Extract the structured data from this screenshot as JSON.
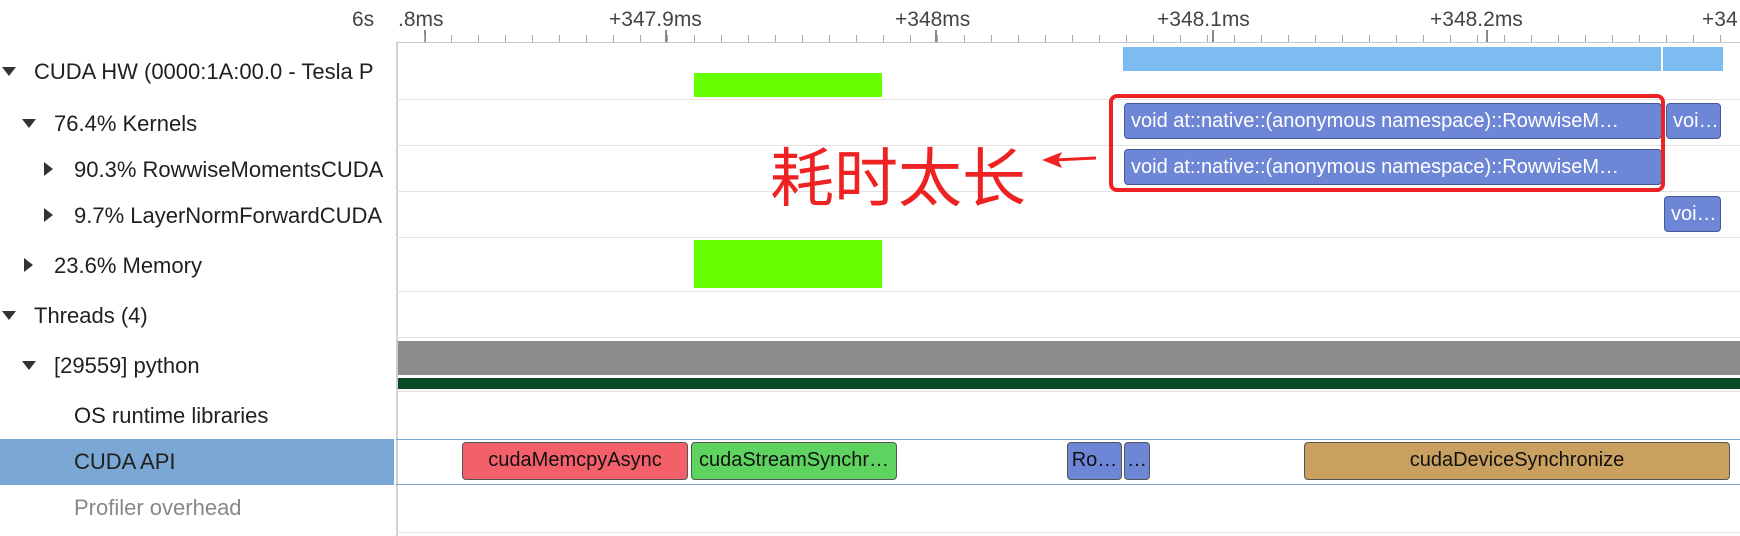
{
  "ruler": {
    "corner_label": "6s",
    "ticks": [
      ".8ms",
      "+347.9ms",
      "+348ms",
      "+348.1ms",
      "+348.2ms",
      "+34"
    ]
  },
  "tree": [
    {
      "label": "CUDA HW (0000:1A:00.0 - Tesla P",
      "expander": "expanded"
    },
    {
      "label": "76.4% Kernels",
      "expander": "expanded"
    },
    {
      "label": "90.3% RowwiseMomentsCUDA",
      "expander": "collapsed"
    },
    {
      "label": "9.7% LayerNormForwardCUDA",
      "expander": "collapsed"
    },
    {
      "label": "23.6% Memory",
      "expander": "collapsed"
    },
    {
      "label": "Threads (4)",
      "expander": "expanded"
    },
    {
      "label": "[29559] python",
      "expander": "expanded"
    },
    {
      "label": "OS runtime libraries",
      "expander": "none"
    },
    {
      "label": "CUDA API",
      "expander": "none",
      "selected": true
    },
    {
      "label": "Profiler overhead",
      "expander": "none"
    }
  ],
  "kernels": {
    "row1_main": "void at::native::(anonymous namespace)::RowwiseM…",
    "row1_small": "voi…",
    "row2_main": "void at::native::(anonymous namespace)::RowwiseM…",
    "row3_small": "voi…"
  },
  "annotation": {
    "text": "耗时太长",
    "color": "#ee2222"
  },
  "api_calls": [
    {
      "label": "cudaMemcpyAsync",
      "color": "#f4606a"
    },
    {
      "label": "cudaStreamSynchr…",
      "color": "#5fd35f"
    },
    {
      "label": "Ro…",
      "color": "#6d86d6"
    },
    {
      "label": "…",
      "color": "#6d86d6"
    },
    {
      "label": "cudaDeviceSynchronize",
      "color": "#caa060"
    }
  ],
  "colors": {
    "selected_row": "#7ba7d4",
    "green_memory": "#66ff00",
    "light_blue": "#7cbcf0",
    "gray_bar": "#8c8c8c",
    "dark_green_bar": "#0a4a24"
  }
}
